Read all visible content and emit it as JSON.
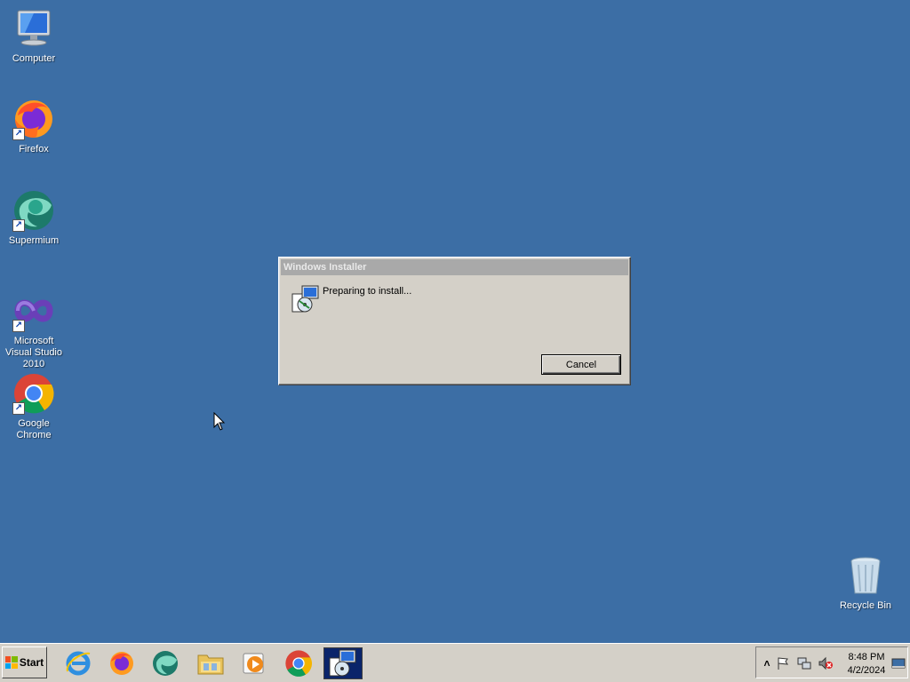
{
  "desktop": {
    "icons": [
      {
        "label": "Computer"
      },
      {
        "label": "Firefox"
      },
      {
        "label": "Supermium"
      },
      {
        "label": "Microsoft Visual Studio 2010"
      },
      {
        "label": "Google Chrome"
      },
      {
        "label": "Recycle Bin"
      }
    ],
    "background_color": "#3c6ea5"
  },
  "dialog": {
    "title": "Windows Installer",
    "message": "Preparing to install...",
    "cancel_label": "Cancel",
    "icon": "installer-icon"
  },
  "taskbar": {
    "start_label": "Start",
    "pinned": [
      {
        "name": "internet-explorer-icon"
      },
      {
        "name": "firefox-icon"
      },
      {
        "name": "supermium-icon"
      },
      {
        "name": "file-explorer-icon"
      },
      {
        "name": "media-player-icon"
      },
      {
        "name": "chrome-icon"
      },
      {
        "name": "windows-installer-icon",
        "active": true
      }
    ],
    "tray": {
      "time": "8:48 PM",
      "date": "4/2/2024",
      "icons": [
        "show-hidden-icons-chevron",
        "action-center-flag-icon",
        "network-icon",
        "volume-muted-icon",
        "show-desktop-icon"
      ]
    }
  }
}
